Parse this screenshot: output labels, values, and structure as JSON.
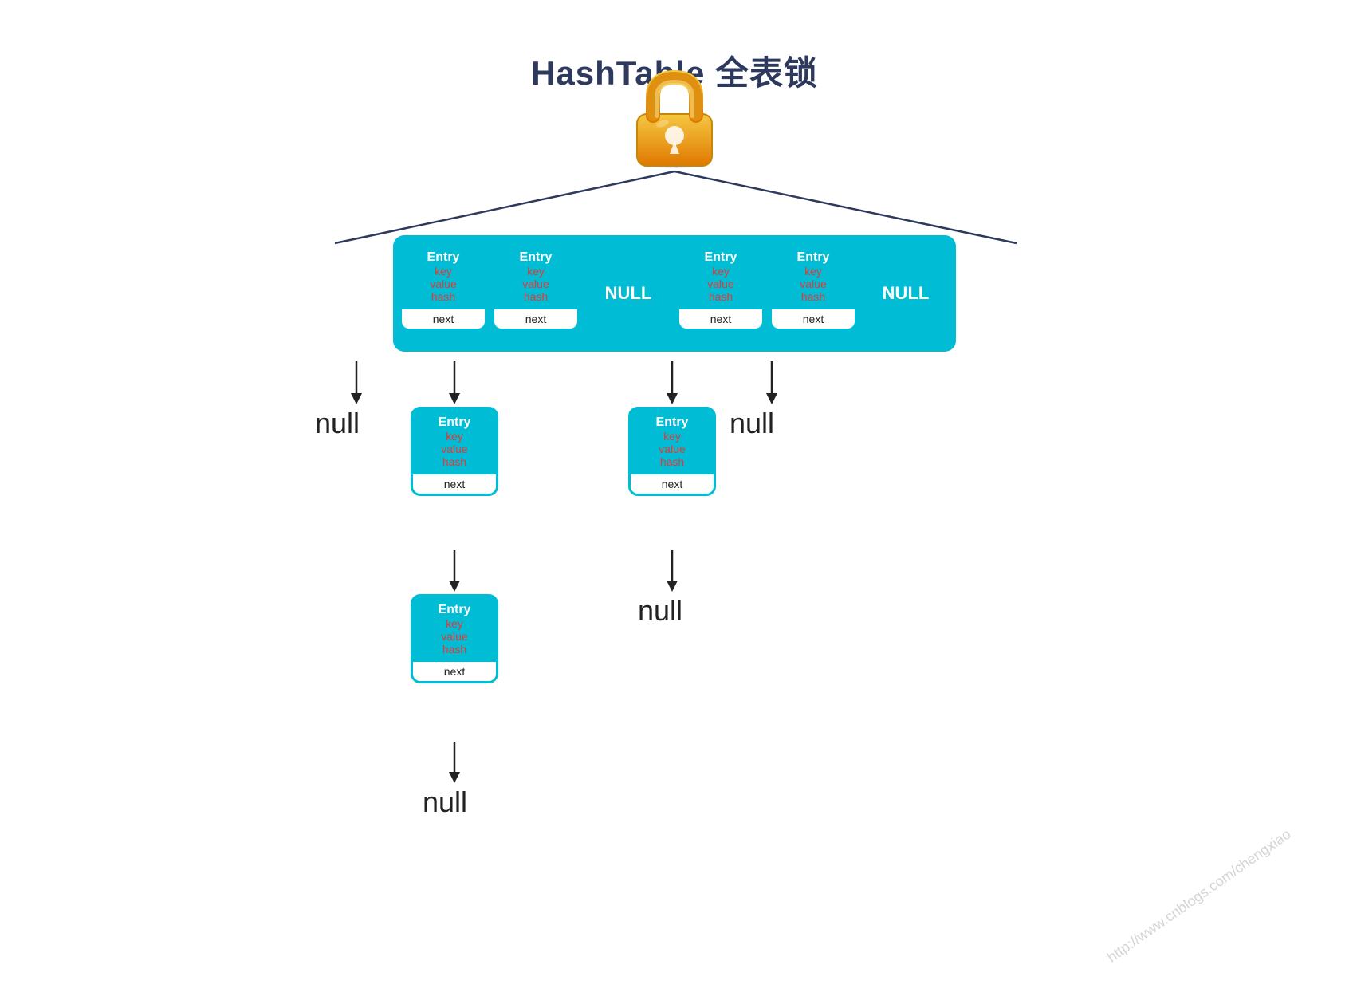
{
  "title": "HashTable 全表锁",
  "watermark": "http://www.cnblogs.com/chengxiao",
  "top_row": {
    "items": [
      {
        "type": "entry",
        "label": "Entry",
        "key": "key",
        "value": "value",
        "hash": "hash",
        "next": "next"
      },
      {
        "type": "entry",
        "label": "Entry",
        "key": "key",
        "value": "value",
        "hash": "hash",
        "next": "next"
      },
      {
        "type": "null",
        "label": "NULL"
      },
      {
        "type": "entry",
        "label": "Entry",
        "key": "key",
        "value": "value",
        "hash": "hash",
        "next": "next"
      },
      {
        "type": "entry",
        "label": "Entry",
        "key": "key",
        "value": "value",
        "hash": "hash",
        "next": "next"
      },
      {
        "type": "null",
        "label": "NULL"
      }
    ]
  },
  "chain1": {
    "entry": {
      "label": "Entry",
      "key": "key",
      "value": "value",
      "hash": "hash",
      "next": "next"
    },
    "null": "null"
  },
  "chain2": {
    "entry1": {
      "label": "Entry",
      "key": "key",
      "value": "value",
      "hash": "hash",
      "next": "next"
    },
    "entry2": {
      "label": "Entry",
      "key": "key",
      "value": "value",
      "hash": "hash",
      "next": "next"
    },
    "null": "null"
  },
  "chain3": {
    "entry": {
      "label": "Entry",
      "key": "key",
      "value": "value",
      "hash": "hash",
      "next": "next"
    },
    "null": "null"
  },
  "chain4": {
    "null": "null"
  },
  "labels": {
    "null_text": "null"
  }
}
